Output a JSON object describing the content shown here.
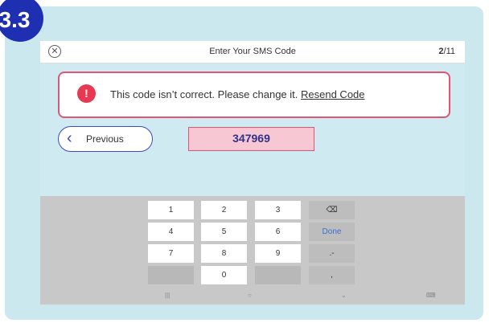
{
  "step_badge": "3.3",
  "topbar": {
    "close_icon": "circle-x-icon",
    "title": "Enter Your SMS Code",
    "counter_current": "2",
    "counter_total": "/11"
  },
  "error": {
    "icon": "alert-icon",
    "message": "This code isn’t correct. Please change it.",
    "link": "Resend Code"
  },
  "previous_button": {
    "icon": "chevron-left-icon",
    "label": "Previous"
  },
  "code_field": {
    "value": "347969"
  },
  "keyboard": {
    "rows": [
      [
        "1",
        "2",
        "3",
        "⌫"
      ],
      [
        "4",
        "5",
        "6",
        "Done"
      ],
      [
        "7",
        "8",
        "9",
        ".-"
      ],
      [
        "",
        "0",
        "",
        ","
      ]
    ],
    "nav": [
      "|||",
      "○",
      "⌄",
      "⌨"
    ]
  },
  "colors": {
    "badge": "#1f2fb2",
    "error_border": "#de5674",
    "code_field_bg": "#f8c7d4",
    "accent": "#3d4bbd"
  }
}
